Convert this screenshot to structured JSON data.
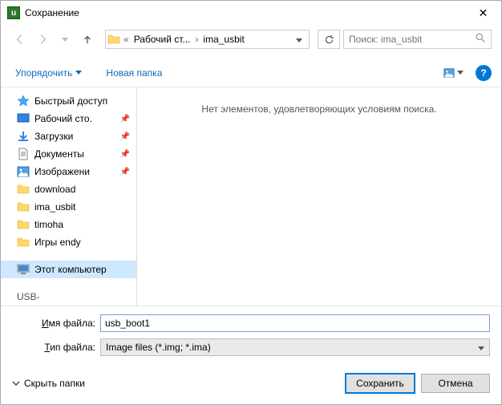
{
  "titlebar": {
    "title": "Сохранение"
  },
  "nav": {
    "crumb_ellipsis": "«",
    "crumb1": "Рабочий ст...",
    "crumb2": "ima_usbit",
    "search_placeholder": "Поиск: ima_usbit"
  },
  "toolbar": {
    "organize": "Упорядочить",
    "newfolder": "Новая папка",
    "help": "?"
  },
  "sidebar": {
    "quick_access": "Быстрый доступ",
    "items": [
      {
        "label": "Рабочий сто.",
        "icon": "desktop",
        "pinned": true
      },
      {
        "label": "Загрузки",
        "icon": "downloads",
        "pinned": true
      },
      {
        "label": "Документы",
        "icon": "documents",
        "pinned": true
      },
      {
        "label": "Изображени",
        "icon": "pictures",
        "pinned": true
      },
      {
        "label": "download",
        "icon": "folder",
        "pinned": false
      },
      {
        "label": "ima_usbit",
        "icon": "folder",
        "pinned": false
      },
      {
        "label": "timoha",
        "icon": "folder",
        "pinned": false
      },
      {
        "label": "Игры endy",
        "icon": "folder",
        "pinned": false
      }
    ],
    "thispc": "Этот компьютер",
    "usb_partial": "USB-"
  },
  "content": {
    "empty": "Нет элементов, удовлетворяющих условиям поиска."
  },
  "fields": {
    "fname_prefix": "И",
    "fname_rest": "мя файла:",
    "ftype_prefix": "Т",
    "ftype_rest": "ип файла:",
    "fname_value": "usb_boot1",
    "ftype_value": "Image files (*.img; *.ima)"
  },
  "footer": {
    "hide_folders": "Скрыть папки",
    "save": "Сохранить",
    "cancel": "Отмена"
  }
}
